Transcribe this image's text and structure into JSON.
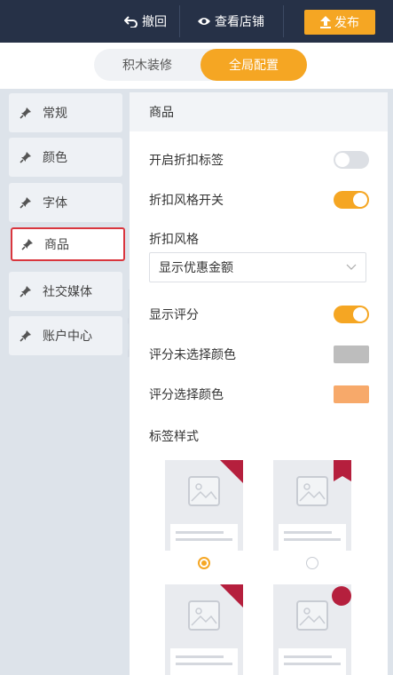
{
  "topbar": {
    "undo_label": "撤回",
    "preview_label": "查看店铺",
    "publish_label": "发布"
  },
  "mode_switch": {
    "left_label": "积木装修",
    "right_label": "全局配置",
    "selected": "全局配置"
  },
  "sidebar": {
    "items": [
      {
        "label": "常规"
      },
      {
        "label": "颜色"
      },
      {
        "label": "字体"
      },
      {
        "label": "商品",
        "active": true
      },
      {
        "label": "社交媒体"
      },
      {
        "label": "账户中心"
      }
    ]
  },
  "panel": {
    "title": "商品",
    "discount_tag_label": "开启折扣标签",
    "discount_tag_on": false,
    "discount_style_switch_label": "折扣风格开关",
    "discount_style_switch_on": true,
    "discount_style_label": "折扣风格",
    "discount_style_value": "显示优惠金额",
    "show_rating_label": "显示评分",
    "show_rating_on": true,
    "rating_unselected_color_label": "评分未选择颜色",
    "rating_unselected_color": "#bdbdbd",
    "rating_selected_color_label": "评分选择颜色",
    "rating_selected_color": "#f7a96a",
    "tag_style_label": "标签样式",
    "tag_styles": [
      {
        "shape": "corner-triangle",
        "selected": true
      },
      {
        "shape": "bookmark-ribbon",
        "selected": false
      },
      {
        "shape": "corner-triangle",
        "selected": false
      },
      {
        "shape": "circle-badge",
        "selected": false
      }
    ]
  },
  "colors": {
    "topbar_bg": "#263147",
    "accent": "#f5a623",
    "tag_red": "#b51f3d",
    "active_outline": "#d9363e"
  }
}
